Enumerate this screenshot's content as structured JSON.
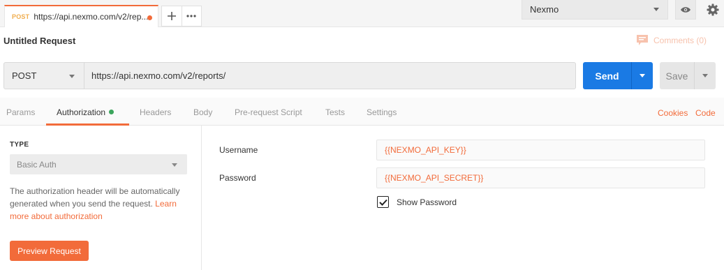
{
  "tab": {
    "method": "POST",
    "url": "https://api.nexmo.com/v2/rep..."
  },
  "environment": {
    "selected": "Nexmo"
  },
  "request": {
    "title": "Untitled Request",
    "comments": "Comments (0)",
    "method": "POST",
    "url": "https://api.nexmo.com/v2/reports/",
    "send_label": "Send",
    "save_label": "Save"
  },
  "subtabs": {
    "params": "Params",
    "authorization": "Authorization",
    "headers": "Headers",
    "body": "Body",
    "prerequest": "Pre-request Script",
    "tests": "Tests",
    "settings": "Settings",
    "cookies": "Cookies",
    "code": "Code"
  },
  "auth": {
    "type_label": "TYPE",
    "type_value": "Basic Auth",
    "description": "The authorization header will be automatically generated when you send the request.",
    "learn_more": "Learn more about authorization",
    "preview_label": "Preview Request",
    "username_label": "Username",
    "username_value": "{{NEXMO_API_KEY}}",
    "password_label": "Password",
    "password_value": "{{NEXMO_API_SECRET}}",
    "show_password_label": "Show Password",
    "show_password_checked": true
  },
  "colors": {
    "accent": "#f26b3a",
    "send": "#1a7ae4",
    "tab_method": "#f0ad4e",
    "auth_indicator": "#3ba55c"
  }
}
